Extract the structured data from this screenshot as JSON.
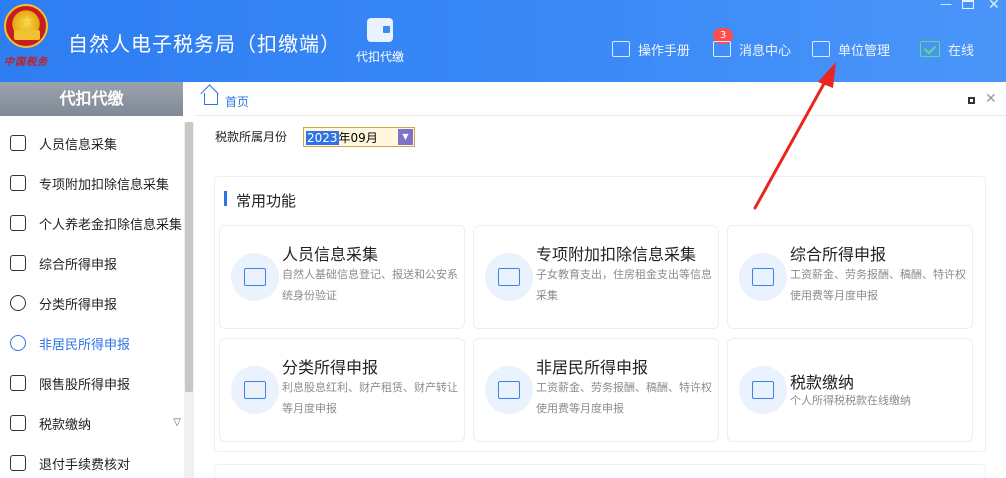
{
  "app": {
    "title": "自然人电子税务局（扣缴端）",
    "logo_text": "中国税务",
    "center_module": "代扣代缴"
  },
  "top_nav": {
    "manual": "操作手册",
    "messages": "消息中心",
    "message_count": "3",
    "unit_mgmt": "单位管理",
    "online": "在线"
  },
  "window_controls": {
    "minimize": "—",
    "close": "✕"
  },
  "sidebar": {
    "header": "代扣代缴",
    "items": [
      {
        "label": "人员信息采集",
        "icon": "person-add-icon"
      },
      {
        "label": "专项附加扣除信息采集",
        "icon": "list-icon"
      },
      {
        "label": "个人养老金扣除信息采集",
        "icon": "document-person-icon"
      },
      {
        "label": "综合所得申报",
        "icon": "layers-icon"
      },
      {
        "label": "分类所得申报",
        "icon": "pie-chart-icon"
      },
      {
        "label": "非居民所得申报",
        "icon": "person-icon"
      },
      {
        "label": "限售股所得申报",
        "icon": "bar-chart-icon"
      },
      {
        "label": "税款缴纳",
        "icon": "wallet-icon"
      },
      {
        "label": "退付手续费核对",
        "icon": "document-check-icon"
      }
    ]
  },
  "breadcrumb": {
    "home": "首页"
  },
  "tax_period": {
    "label": "税款所属月份",
    "year": "2023",
    "month": "年09月"
  },
  "common_functions": {
    "title": "常用功能",
    "cards": [
      {
        "title": "人员信息采集",
        "desc": "自然人基础信息登记、报送和公安系统身份验证",
        "icon": "id-card-icon"
      },
      {
        "title": "专项附加扣除信息采集",
        "desc": "子女教育支出，住房租金支出等信息采集",
        "icon": "tax-calendar-icon"
      },
      {
        "title": "综合所得申报",
        "desc": "工资薪金、劳务报酬、稿酬、特许权使用费等月度申报",
        "icon": "form-icon"
      },
      {
        "title": "分类所得申报",
        "desc": "利息股息红利、财产租赁、财产转让等月度申报",
        "icon": "edit-icon"
      },
      {
        "title": "非居民所得申报",
        "desc": "工资薪金、劳务报酬、稿酬、特许权使用费等月度申报",
        "icon": "edit-icon"
      },
      {
        "title": "税款缴纳",
        "desc": "个人所得税税款在线缴纳",
        "icon": "payment-search-icon"
      }
    ]
  },
  "colors": {
    "header_blue": "#3b8af7",
    "accent_blue": "#2e74e6",
    "badge_red": "#ff4c4c",
    "online_green": "#5ee07a",
    "annotation_red": "#e8251f"
  }
}
